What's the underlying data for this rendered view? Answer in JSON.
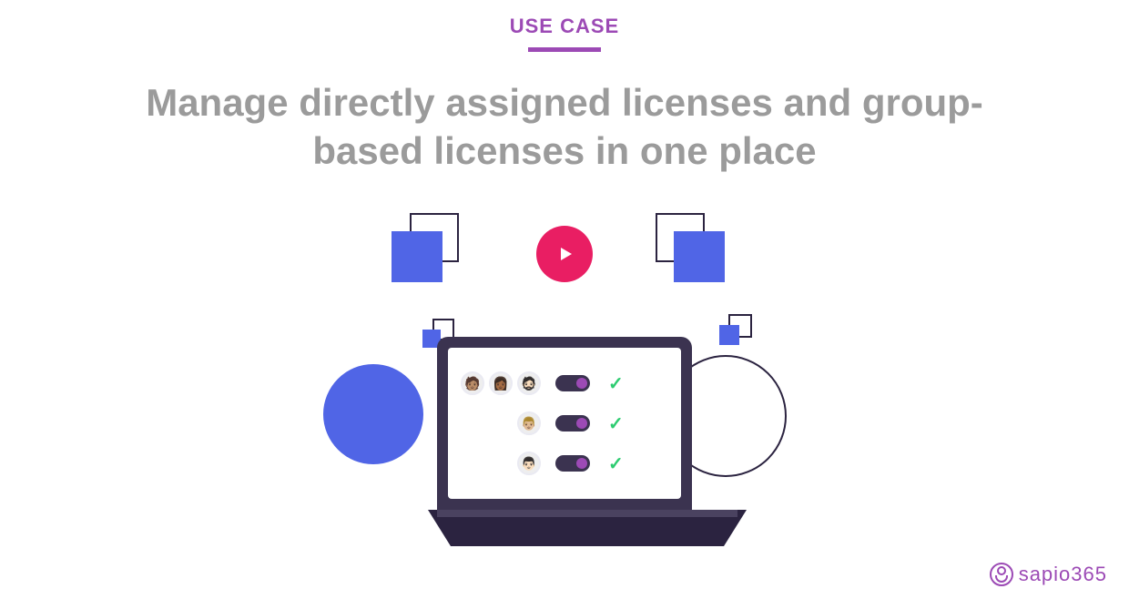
{
  "eyebrow": "USE CASE",
  "headline": "Manage directly assigned licenses and group-based licenses in one place",
  "brand": "sapio365",
  "colors": {
    "accent": "#9c4ab5",
    "blue": "#5065e6",
    "red": "#e91e63",
    "green": "#2ecc71",
    "dark": "#2b2340"
  },
  "screen_rows": [
    {
      "avatars": 3,
      "toggle": true,
      "check": true
    },
    {
      "avatars": 1,
      "toggle": true,
      "check": true
    },
    {
      "avatars": 1,
      "toggle": true,
      "check": true
    }
  ]
}
